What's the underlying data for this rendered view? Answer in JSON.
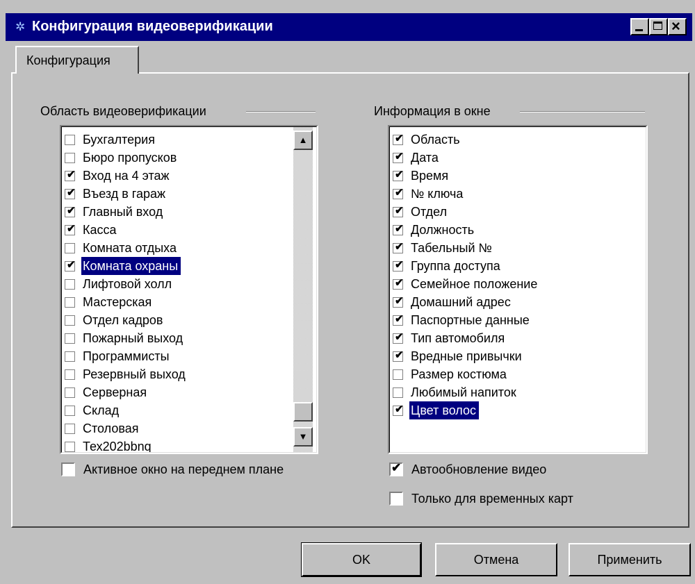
{
  "window": {
    "title": "Конфигурация видеоверификации",
    "title_icon": "app-icon",
    "controls": [
      "minimize-icon",
      "maximize-icon",
      "close-icon"
    ]
  },
  "tabs": [
    {
      "label": "Конфигурация",
      "active": true
    }
  ],
  "area_group": {
    "label": "Область видеоверификации",
    "items": [
      {
        "label": "Бухгалтерия",
        "checked": false,
        "selected": false
      },
      {
        "label": "Бюро пропусков",
        "checked": false,
        "selected": false
      },
      {
        "label": "Вход на 4 этаж",
        "checked": true,
        "selected": false
      },
      {
        "label": "Въезд в гараж",
        "checked": true,
        "selected": false
      },
      {
        "label": "Главный вход",
        "checked": true,
        "selected": false
      },
      {
        "label": "Касса",
        "checked": true,
        "selected": false
      },
      {
        "label": "Комната отдыха",
        "checked": false,
        "selected": false
      },
      {
        "label": "Комната охраны",
        "checked": true,
        "selected": true
      },
      {
        "label": "Лифтовой холл",
        "checked": false,
        "selected": false
      },
      {
        "label": "Мастерская",
        "checked": false,
        "selected": false
      },
      {
        "label": "Отдел кадров",
        "checked": false,
        "selected": false
      },
      {
        "label": "Пожарный выход",
        "checked": false,
        "selected": false
      },
      {
        "label": "Программисты",
        "checked": false,
        "selected": false
      },
      {
        "label": "Резервный выход",
        "checked": false,
        "selected": false
      },
      {
        "label": "Серверная",
        "checked": false,
        "selected": false
      },
      {
        "label": "Склад",
        "checked": false,
        "selected": false
      },
      {
        "label": "Столовая",
        "checked": false,
        "selected": false
      },
      {
        "label": "Тех202bbnq",
        "checked": false,
        "selected": false
      }
    ],
    "foreground_checkbox": {
      "label": "Активное окно на переднем плане",
      "checked": false
    }
  },
  "info_group": {
    "label": "Информация в окне",
    "items": [
      {
        "label": "Область",
        "checked": true,
        "selected": false
      },
      {
        "label": "Дата",
        "checked": true,
        "selected": false
      },
      {
        "label": "Время",
        "checked": true,
        "selected": false
      },
      {
        "label": "№ ключа",
        "checked": true,
        "selected": false
      },
      {
        "label": "Отдел",
        "checked": true,
        "selected": false
      },
      {
        "label": "Должность",
        "checked": true,
        "selected": false
      },
      {
        "label": "Табельный №",
        "checked": true,
        "selected": false
      },
      {
        "label": "Группа доступа",
        "checked": true,
        "selected": false
      },
      {
        "label": "Семейное положение",
        "checked": true,
        "selected": false
      },
      {
        "label": "Домашний адрес",
        "checked": true,
        "selected": false
      },
      {
        "label": "Паспортные данные",
        "checked": true,
        "selected": false
      },
      {
        "label": "Тип автомобиля",
        "checked": true,
        "selected": false
      },
      {
        "label": "Вредные привычки",
        "checked": true,
        "selected": false
      },
      {
        "label": "Размер костюма",
        "checked": false,
        "selected": false
      },
      {
        "label": "Любимый напиток",
        "checked": false,
        "selected": false
      },
      {
        "label": "Цвет волос",
        "checked": true,
        "selected": true
      }
    ],
    "auto_update_checkbox": {
      "label": "Автообновление видео",
      "checked": true
    },
    "temp_cards_checkbox": {
      "label": "Только для временных карт",
      "checked": false
    }
  },
  "buttons": {
    "ok": "OK",
    "cancel": "Отмена",
    "apply": "Применить"
  },
  "colors": {
    "title_bar": "#000080",
    "selection": "#000080",
    "face": "#c0c0c0"
  },
  "check_glyph": "✔"
}
